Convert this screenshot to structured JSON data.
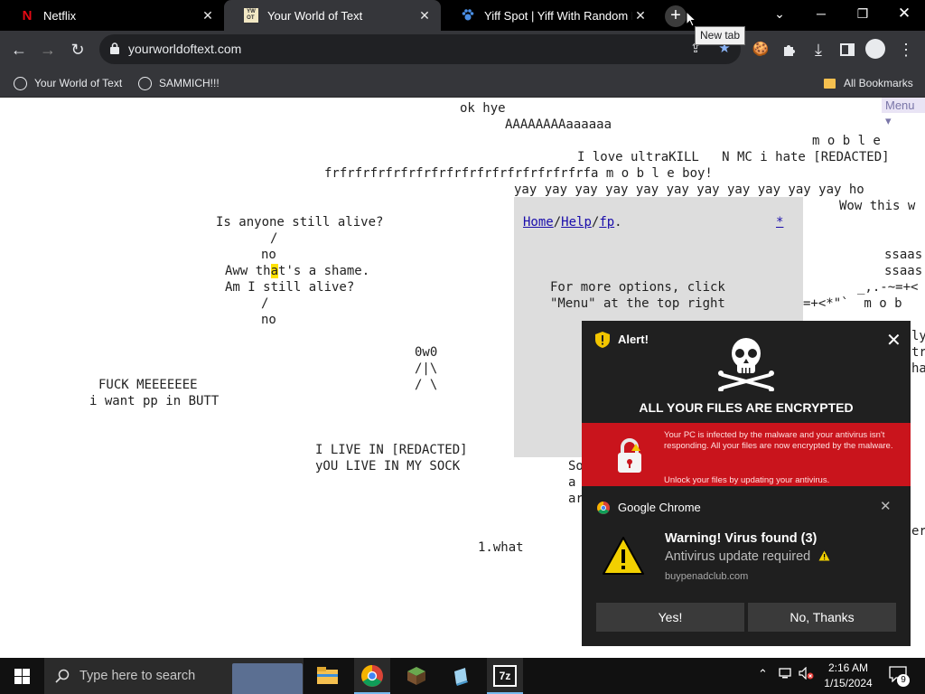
{
  "tabs": [
    {
      "title": "Netflix",
      "favicon": "netflix-icon",
      "active": false
    },
    {
      "title": "Your World of Text",
      "favicon": "ywot-icon",
      "active": true
    },
    {
      "title": "Yiff Spot | Yiff With Random Fur",
      "favicon": "paw-icon",
      "active": false
    }
  ],
  "tooltip": "New tab",
  "address_bar": {
    "url": "yourworldoftext.com"
  },
  "bookmarks": [
    {
      "label": "Your World of Text"
    },
    {
      "label": "SAMMICH!!!"
    }
  ],
  "all_bookmarks_label": "All Bookmarks",
  "page": {
    "menu_label": "Menu",
    "lines": {
      "l1": "ok hye",
      "l2": "AAAAAAAAaaaaaa",
      "l3": "m o b l e",
      "l4": "I love ultraKILL   N MC i hate [REDACTED]",
      "l5": "frfrfrfrfrfrfrfrfrfrfrfrfrfrfrfrfrfa m o b l e boy!",
      "l6": "yay yay yay yay yay yay yay yay yay yay yay ho",
      "l7": "Wow this w",
      "l8": "Is anyone still alive?",
      "l9": "/",
      "l10": "no",
      "l11_a": "Aww th",
      "l11_b": "a",
      "l11_c": "t's a shame.",
      "l12": "Am I still alive?",
      "l13": "/",
      "l14": "no",
      "l15": "0w0",
      "l16": "/|\\",
      "l17": "/ \\",
      "l18": "FUCK MEEEEEEE",
      "l19": "i want pp in BUTT",
      "l20": "I LIVE IN [REDACTED]",
      "l21": "yOU LIVE IN MY SOCK",
      "l22": "1.what",
      "r1": "ssaas",
      "r2": "ssaas",
      "r3": "_,.-~=+<",
      "r4": "=+<*\"`  m o b",
      "r5": "ly",
      "r6": "tr",
      "r7": "ha",
      "r8": "So",
      "r9": "a",
      "r10": "ar",
      "r11": "er"
    },
    "help_box": {
      "link_home": "Home",
      "link_help": "Help",
      "link_fp": "fp",
      "star": "*",
      "text1": "For more options, click",
      "text2": "\"Menu\" at the top right"
    }
  },
  "scam_alert": {
    "title": "Alert!",
    "headline": "ALL YOUR FILES ARE ENCRYPTED",
    "message": "Your PC is infected by the malware and your antivirus isn't responding. All your files are now encrypted by the malware.",
    "message2": "Unlock your files by updating your antivirus."
  },
  "notification": {
    "app": "Google Chrome",
    "title": "Warning! Virus found (3)",
    "body": "Antivirus update required",
    "source": "buypenadclub.com",
    "yes_label": "Yes!",
    "no_label": "No, Thanks"
  },
  "taskbar": {
    "search_placeholder": "Type here to search",
    "time": "2:16 AM",
    "date": "1/15/2024",
    "notification_count": "9"
  },
  "colors": {
    "tab_strip": "#000000",
    "toolbar": "#35363a",
    "alert_red": "#c9141c",
    "highlight": "#ffe100",
    "link": "#1a0dab"
  }
}
